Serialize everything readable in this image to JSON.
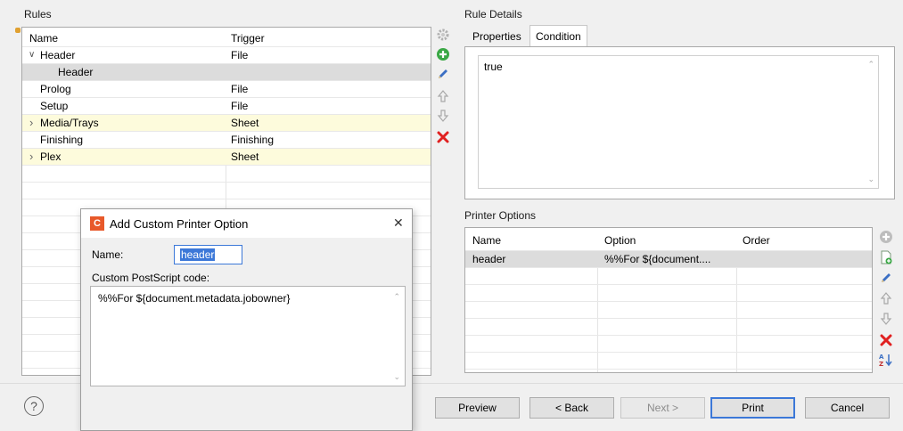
{
  "rules": {
    "title": "Rules",
    "columns": [
      "Name",
      "Trigger"
    ],
    "rows": [
      {
        "name": "Header",
        "trigger": "File",
        "expander": "∨"
      },
      {
        "name": "Header",
        "trigger": "",
        "expander": ""
      },
      {
        "name": "Prolog",
        "trigger": "File",
        "expander": ""
      },
      {
        "name": "Setup",
        "trigger": "File",
        "expander": ""
      },
      {
        "name": "Media/Trays",
        "trigger": "Sheet",
        "expander": "›"
      },
      {
        "name": "Finishing",
        "trigger": "Finishing",
        "expander": ""
      },
      {
        "name": "Plex",
        "trigger": "Sheet",
        "expander": "›"
      }
    ]
  },
  "rule_details": {
    "title": "Rule Details",
    "tabs": [
      "Properties",
      "Condition"
    ],
    "condition_text": "true"
  },
  "printer_options": {
    "title": "Printer Options",
    "columns": [
      "Name",
      "Option",
      "Order"
    ],
    "rows": [
      {
        "name": "header",
        "option": "%%For ${document....",
        "order": ""
      }
    ]
  },
  "dialog": {
    "title": "Add Custom Printer Option",
    "logo_letter": "C",
    "name_label": "Name:",
    "name_value": "header",
    "code_label": "Custom PostScript code:",
    "code_value": "%%For ${document.metadata.jobowner}",
    "close_glyph": "✕"
  },
  "footer": {
    "help_glyph": "?",
    "preview": "Preview",
    "back": "< Back",
    "next": "Next >",
    "print": "Print",
    "cancel": "Cancel"
  },
  "colors": {
    "selected_row": "#dcdcdc",
    "highlight_row": "#fdfbdc",
    "accent": "#3c78d8",
    "dialog_logo": "#e8592a"
  }
}
